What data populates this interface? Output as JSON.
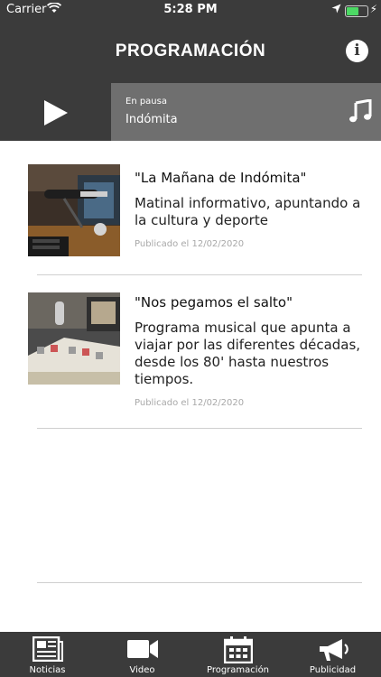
{
  "status_bar": {
    "carrier": "Carrier",
    "time": "5:28 PM"
  },
  "header": {
    "title": "PROGRAMACIÓN"
  },
  "player": {
    "state": "En pausa",
    "station": "Indómita"
  },
  "programs": [
    {
      "title": "\"La Mañana de Indómita\"",
      "description": "Matinal informativo, apuntando a la cultura y deporte",
      "date": "Publicado el 12/02/2020"
    },
    {
      "title": "\"Nos pegamos el salto\"",
      "description": "Programa musical que apunta a viajar por las diferentes décadas, desde los 80' hasta nuestros tiempos.",
      "date": "Publicado el 12/02/2020"
    }
  ],
  "tabs": [
    {
      "label": "Noticias",
      "icon": "newspaper-icon"
    },
    {
      "label": "Video",
      "icon": "video-camera-icon"
    },
    {
      "label": "Programación",
      "icon": "calendar-icon"
    },
    {
      "label": "Publicidad",
      "icon": "megaphone-icon"
    }
  ],
  "colors": {
    "bar": "#3b3b3b",
    "player": "#6f6f6f",
    "battery": "#4cd964"
  },
  "battery_level": 0.6
}
